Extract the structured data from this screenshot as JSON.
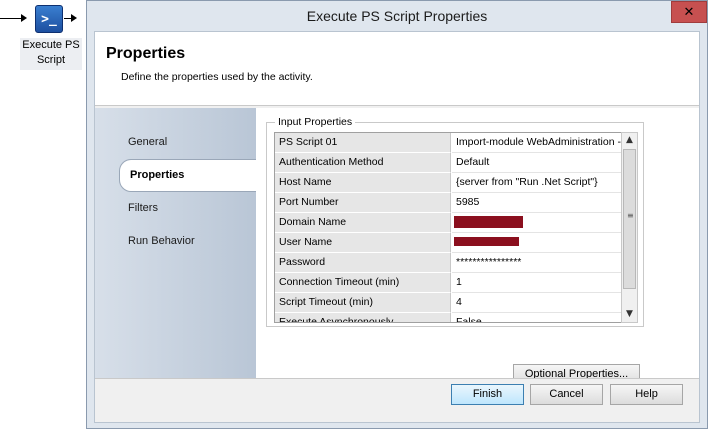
{
  "canvas": {
    "activity_label": "Execute PS Script",
    "icon_glyph": ">_"
  },
  "window": {
    "title": "Execute PS Script Properties",
    "close_glyph": "✕"
  },
  "header": {
    "title": "Properties",
    "subtitle": "Define the properties used by the activity."
  },
  "sidebar": {
    "items": [
      {
        "label": "General"
      },
      {
        "label": "Properties",
        "active": true
      },
      {
        "label": "Filters"
      },
      {
        "label": "Run Behavior"
      }
    ]
  },
  "input_properties": {
    "label": "Input Properties",
    "rows": [
      {
        "name": "PS Script 01",
        "value": "Import-module WebAdministration -C"
      },
      {
        "name": "Authentication Method",
        "value": "Default"
      },
      {
        "name": "Host Name",
        "value": "{server from \"Run .Net Script\"}"
      },
      {
        "name": "Port Number",
        "value": "5985"
      },
      {
        "name": "Domain Name",
        "value": ""
      },
      {
        "name": "User Name",
        "value": ""
      },
      {
        "name": "Password",
        "value": "****************"
      },
      {
        "name": "Connection Timeout (min)",
        "value": "1"
      },
      {
        "name": "Script Timeout (min)",
        "value": "4"
      },
      {
        "name": "Execute Asynchronously",
        "value": "False"
      }
    ],
    "optional_button": "Optional Properties..."
  },
  "footer": {
    "finish": "Finish",
    "cancel": "Cancel",
    "help": "Help"
  },
  "colors": {
    "redaction": "#8b0f1e",
    "close_button": "#c75050"
  }
}
